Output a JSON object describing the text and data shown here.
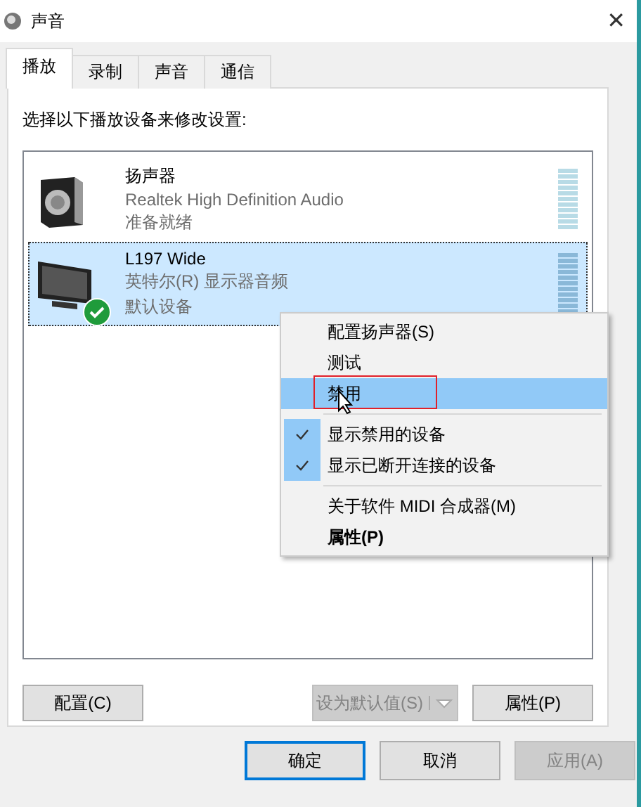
{
  "window": {
    "title": "声音",
    "close": "✕"
  },
  "tabs": [
    {
      "label": "播放",
      "selected": true
    },
    {
      "label": "录制",
      "selected": false
    },
    {
      "label": "声音",
      "selected": false
    },
    {
      "label": "通信",
      "selected": false
    }
  ],
  "instruction": "选择以下播放设备来修改设置:",
  "devices": [
    {
      "kind": "speaker",
      "name": "扬声器",
      "driver": "Realtek High Definition Audio",
      "status": "准备就绪",
      "selected": false,
      "default": false
    },
    {
      "kind": "monitor",
      "name": "L197 Wide",
      "driver": "英特尔(R) 显示器音频",
      "status": "默认设备",
      "selected": true,
      "default": true
    }
  ],
  "context_menu": [
    {
      "kind": "item",
      "label": "配置扬声器(S)",
      "selected": false,
      "checked": false,
      "bold": false
    },
    {
      "kind": "item",
      "label": "测试",
      "selected": false,
      "checked": false,
      "bold": false
    },
    {
      "kind": "item",
      "label": "禁用",
      "selected": true,
      "checked": false,
      "bold": false
    },
    {
      "kind": "separator"
    },
    {
      "kind": "item",
      "label": "显示禁用的设备",
      "selected": false,
      "checked": true,
      "bold": false
    },
    {
      "kind": "item",
      "label": "显示已断开连接的设备",
      "selected": false,
      "checked": true,
      "bold": false
    },
    {
      "kind": "separator"
    },
    {
      "kind": "item",
      "label": "关于软件 MIDI 合成器(M)",
      "selected": false,
      "checked": false,
      "bold": false
    },
    {
      "kind": "item",
      "label": "属性(P)",
      "selected": false,
      "checked": false,
      "bold": true
    }
  ],
  "panel_buttons": [
    {
      "kind": "plain",
      "label": "配置(C)",
      "disabled": false
    },
    {
      "kind": "split",
      "label": "设为默认值(S)",
      "disabled": true
    },
    {
      "kind": "plain",
      "label": "属性(P)",
      "disabled": false
    }
  ],
  "dialog_buttons": [
    {
      "label": "确定",
      "disabled": false,
      "default": true
    },
    {
      "label": "取消",
      "disabled": false,
      "default": false
    },
    {
      "label": "应用(A)",
      "disabled": true,
      "default": false
    }
  ]
}
